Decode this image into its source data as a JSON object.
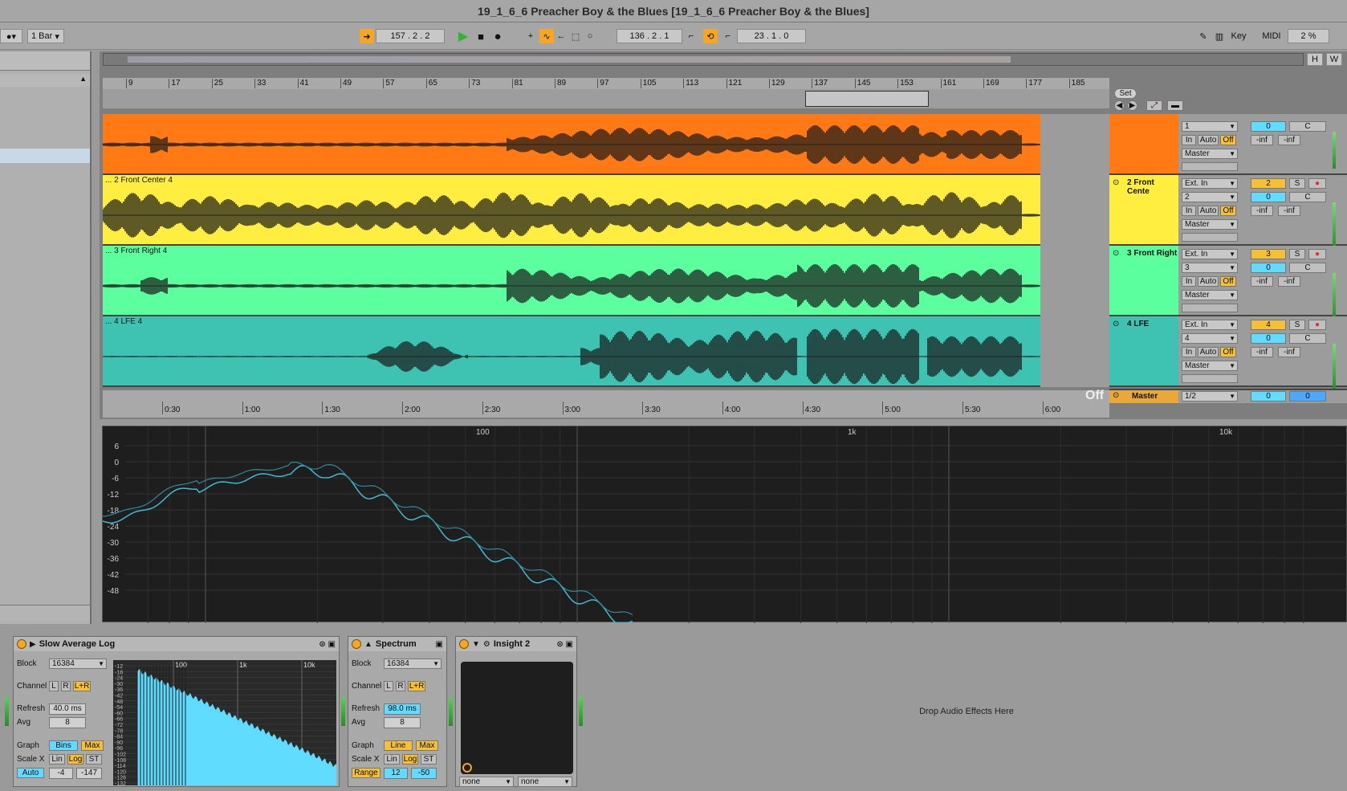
{
  "window": {
    "title": "19_1_6_6 Preacher Boy & the Blues  [19_1_6_6 Preacher Boy & the Blues]"
  },
  "toolbar": {
    "quantize": "1 Bar",
    "arrangement_position": "157 .   2 .   2",
    "loop_start": "136 .   2 .   1",
    "loop_length": "23 .   1 .   0",
    "key_label": "Key",
    "midi_label": "MIDI",
    "cpu": "2 %",
    "h_label": "H",
    "w_label": "W"
  },
  "ruler": {
    "bars": [
      "9",
      "17",
      "25",
      "33",
      "41",
      "49",
      "57",
      "65",
      "73",
      "81",
      "89",
      "97",
      "105",
      "113",
      "121",
      "129",
      "137",
      "145",
      "153",
      "161",
      "169",
      "177",
      "185"
    ]
  },
  "set_button": "Set",
  "tracks": [
    {
      "clip_name": "",
      "name": "",
      "color": "#ff7a14",
      "input_type": "",
      "input_channel": "1",
      "track_number": "",
      "monitor": [
        "In",
        "Auto",
        "Off"
      ],
      "output": "Master",
      "volume": "0",
      "pan": "C",
      "peak_l": "-inf",
      "peak_r": "-inf"
    },
    {
      "clip_name": "... 2 Front Center 4",
      "name": "2 Front Cente",
      "color": "#ffee40",
      "input_type": "Ext. In",
      "input_channel": "2",
      "track_number": "2",
      "monitor": [
        "In",
        "Auto",
        "Off"
      ],
      "output": "Master",
      "volume": "0",
      "pan": "C",
      "peak_l": "-inf",
      "peak_r": "-inf"
    },
    {
      "clip_name": "... 3 Front Right 4",
      "name": "3 Front Right",
      "color": "#5bff9e",
      "input_type": "Ext. In",
      "input_channel": "3",
      "track_number": "3",
      "monitor": [
        "In",
        "Auto",
        "Off"
      ],
      "output": "Master",
      "volume": "0",
      "pan": "C",
      "peak_l": "-inf",
      "peak_r": "-inf"
    },
    {
      "clip_name": "... 4 LFE 4",
      "name": "4 LFE",
      "color": "#3ec2b2",
      "input_type": "Ext. In",
      "input_channel": "4",
      "track_number": "4",
      "monitor": [
        "In",
        "Auto",
        "Off"
      ],
      "output": "Master",
      "volume": "0",
      "pan": "C",
      "peak_l": "-inf",
      "peak_r": "-inf"
    }
  ],
  "solo_label": "S",
  "master": {
    "name": "Master",
    "output": "1/2",
    "volume": "0",
    "pan": "0",
    "off_label": "Off"
  },
  "timeline": {
    "times": [
      "0:30",
      "1:00",
      "1:30",
      "2:00",
      "2:30",
      "3:00",
      "3:30",
      "4:00",
      "4:30",
      "5:00",
      "5:30",
      "6:00"
    ]
  },
  "spectrum_view": {
    "y_labels": [
      "6",
      "0",
      "-6",
      "-12",
      "-18",
      "-24",
      "-30",
      "-36",
      "-42",
      "-48"
    ],
    "x_labels": [
      "100",
      "1k",
      "10k"
    ]
  },
  "devices": {
    "device1": {
      "title": "Slow Average Log",
      "block_label": "Block",
      "block_value": "16384",
      "channel_label": "Channel",
      "channels": [
        "L",
        "R",
        "L+R"
      ],
      "refresh_label": "Refresh",
      "refresh_value": "40.0 ms",
      "avg_label": "Avg",
      "avg_value": "8",
      "graph_label": "Graph",
      "graph_mode": "Bins",
      "graph_max": "Max",
      "scalex_label": "Scale X",
      "scale_lin": "Lin",
      "scale_log": "Log",
      "scale_st": "ST",
      "auto_label": "Auto",
      "range_min": "-4",
      "range_max": "-147",
      "mini_x": [
        "100",
        "1k",
        "10k"
      ],
      "mini_y": [
        "-12",
        "-18",
        "-24",
        "-30",
        "-36",
        "-42",
        "-48",
        "-54",
        "-60",
        "-66",
        "-72",
        "-78",
        "-84",
        "-90",
        "-96",
        "-102",
        "-108",
        "-114",
        "-120",
        "-126",
        "-132"
      ]
    },
    "device2": {
      "title": "Spectrum",
      "block_label": "Block",
      "block_value": "16384",
      "channel_label": "Channel",
      "channels": [
        "L",
        "R",
        "L+R"
      ],
      "refresh_label": "Refresh",
      "refresh_value": "98.0 ms",
      "avg_label": "Avg",
      "avg_value": "8",
      "graph_label": "Graph",
      "graph_mode": "Line",
      "graph_max": "Max",
      "scalex_label": "Scale X",
      "scale_lin": "Lin",
      "scale_log": "Log",
      "scale_st": "ST",
      "range_label": "Range",
      "range_min": "12",
      "range_max": "-50"
    },
    "device3": {
      "title": "Insight 2",
      "select_a": "none",
      "select_b": "none"
    },
    "drop_text": "Drop Audio Effects Here"
  }
}
